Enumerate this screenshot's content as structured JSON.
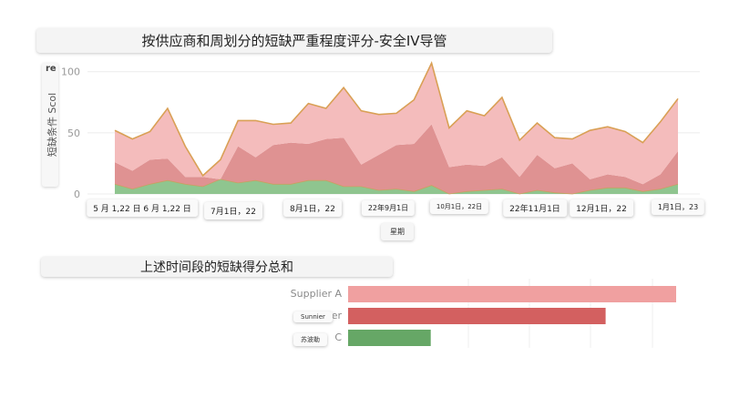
{
  "titles": {
    "chart1": "按供应商和周划分的短缺严重程度评分-安全IV导管",
    "chart2": "上述时间段的短缺得分总和"
  },
  "chart_data": [
    {
      "type": "area",
      "title": "按供应商和周划分的短缺严重程度评分-安全IV导管",
      "ylabel": "短缺条件 Scol",
      "ylabel_fragment": "re",
      "xlabel": "星期",
      "ylim": [
        0,
        108
      ],
      "yticks": [
        0,
        50,
        100
      ],
      "xtick_labels": [
        "5 月 1,22 日 6 月 1,22 日",
        "7月1日，22",
        "8月1日，22",
        "22年9月1日",
        "10月1日，22日",
        "22年11月1日",
        "12月1日，22",
        "1月1日，23"
      ],
      "stacked": true,
      "series": [
        {
          "name": "",
          "color": "#8fc58f",
          "values": [
            8,
            4,
            8,
            11,
            8,
            6,
            12,
            9,
            11,
            8,
            8,
            11,
            11,
            6,
            6,
            3,
            4,
            2,
            7,
            0,
            2,
            3,
            4,
            0,
            3,
            1,
            0,
            3,
            5,
            5,
            2,
            4,
            8
          ]
        },
        {
          "name": "",
          "color": "#df9292",
          "values": [
            18,
            15,
            20,
            18,
            6,
            8,
            0,
            30,
            19,
            32,
            34,
            30,
            34,
            40,
            18,
            29,
            36,
            39,
            50,
            22,
            22,
            20,
            26,
            14,
            29,
            20,
            25,
            9,
            11,
            9,
            6,
            12,
            27
          ]
        },
        {
          "name": "",
          "color": "#f4bcbc",
          "values": [
            26,
            26,
            23,
            41,
            25,
            1,
            16,
            21,
            30,
            17,
            16,
            33,
            25,
            41,
            44,
            33,
            26,
            36,
            50,
            32,
            44,
            41,
            49,
            30,
            26,
            25,
            20,
            40,
            39,
            37,
            34,
            43,
            43
          ]
        }
      ]
    },
    {
      "type": "bar",
      "orientation": "horizontal",
      "title": "上述时间段的短缺得分总和",
      "categories": [
        "Supplier A",
        "Sunnier",
        "C"
      ],
      "category_pills": [
        "",
        "Sunnier",
        "苏波勒"
      ],
      "values": [
        1000,
        785,
        252
      ],
      "colors": [
        "#f0a0a0",
        "#d36060",
        "#66a766"
      ]
    }
  ]
}
